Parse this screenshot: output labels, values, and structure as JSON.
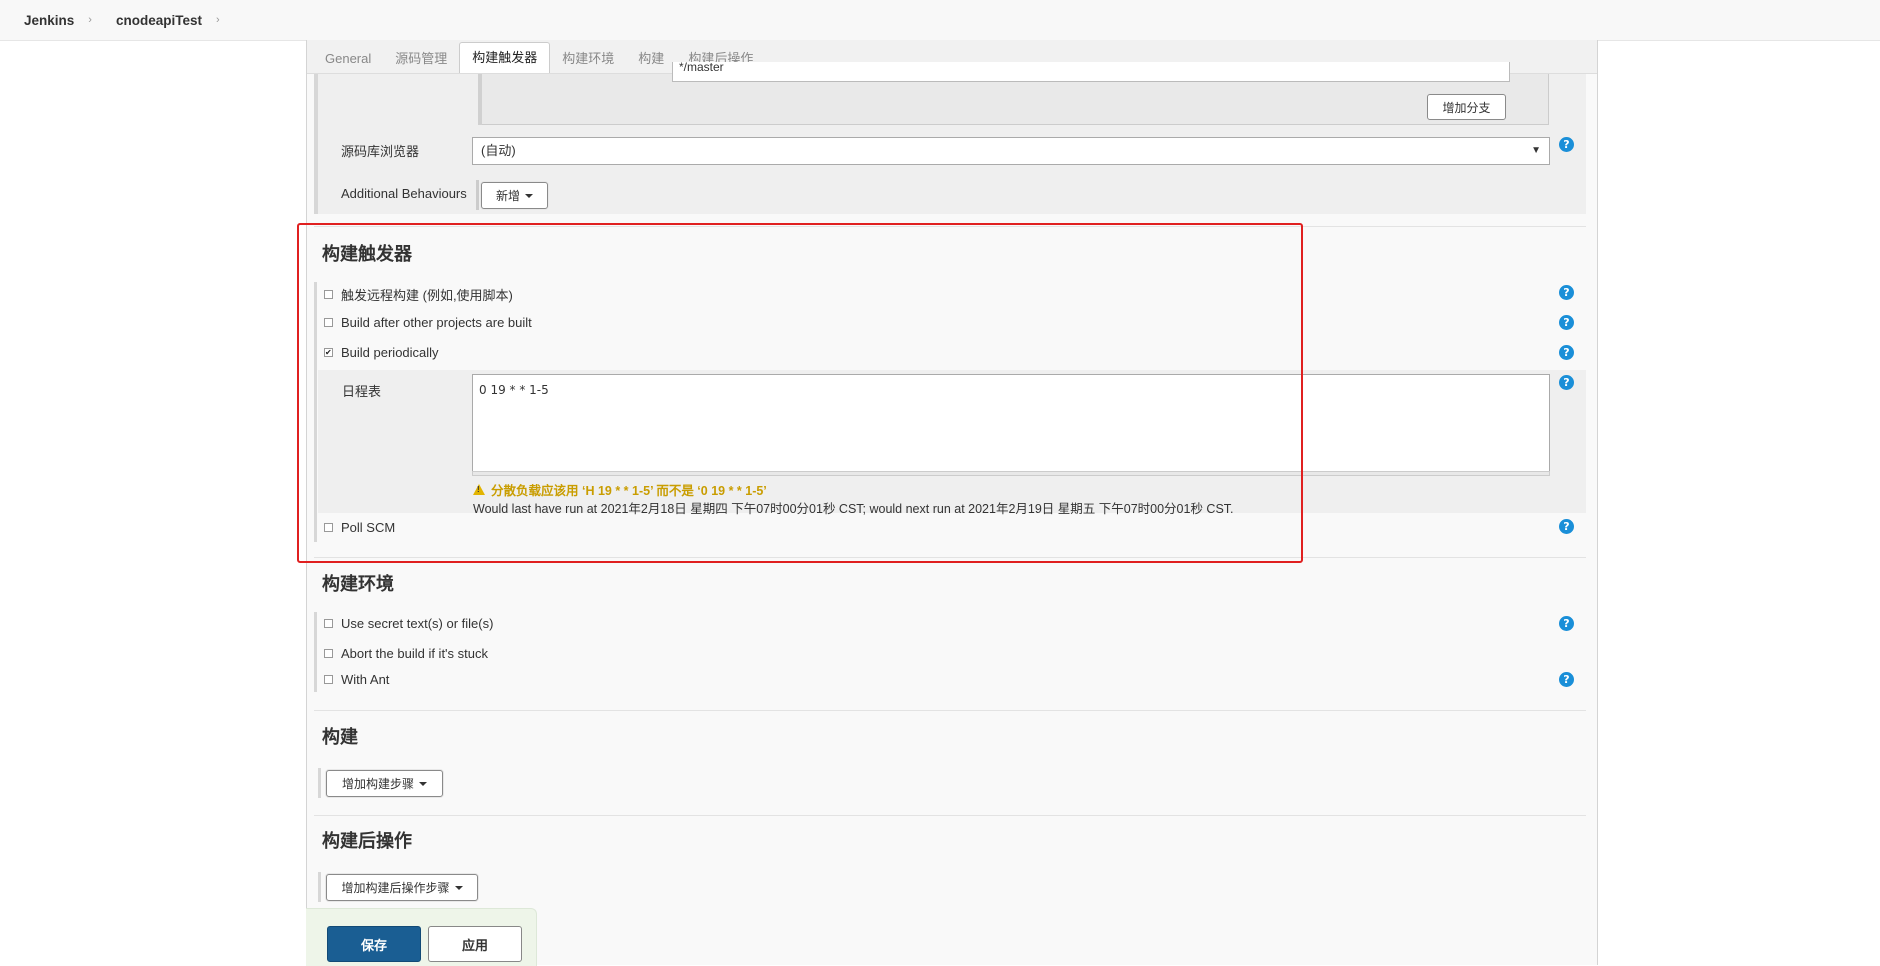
{
  "breadcrumb": {
    "root": "Jenkins",
    "job": "cnodeapiTest"
  },
  "tabs": [
    "General",
    "源码管理",
    "构建触发器",
    "构建环境",
    "构建",
    "构建后操作"
  ],
  "scm": {
    "branch_spec_value": "*/master",
    "add_branch_button": "增加分支",
    "browser_label": "源码库浏览器",
    "browser_value": "(自动)",
    "behaviours_label": "Additional Behaviours",
    "add_button": "新增"
  },
  "triggers": {
    "title": "构建触发器",
    "remote": "触发远程构建 (例如,使用脚本)",
    "after_other": "Build after other projects are built",
    "periodically": "Build periodically",
    "periodically_checked": true,
    "schedule_label": "日程表",
    "schedule_value": "0 19 * * 1-5",
    "warning": "分散负载应该用 ‘H 19 * * 1-5’ 而不是 ‘0 19 * * 1-5’",
    "run_info": "Would last have run at 2021年2月18日 星期四 下午07时00分01秒 CST; would next run at 2021年2月19日 星期五 下午07时00分01秒 CST.",
    "poll_scm": "Poll SCM"
  },
  "env": {
    "title": "构建环境",
    "secret": "Use secret text(s) or file(s)",
    "abort": "Abort the build if it's stuck",
    "ant": "With Ant"
  },
  "build": {
    "title": "构建",
    "add_step": "增加构建步骤"
  },
  "post": {
    "title": "构建后操作",
    "add_step": "增加构建后操作步骤"
  },
  "actions": {
    "save": "保存",
    "apply": "应用"
  },
  "help_symbol": "?",
  "colors": {
    "highlight_border": "#e02020",
    "primary_button": "#1a5e93",
    "help_icon": "#1a8fd8"
  }
}
